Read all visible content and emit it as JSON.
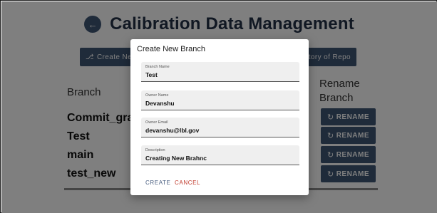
{
  "header": {
    "title": "Calibration Data Management",
    "back_icon": "arrow-left-icon"
  },
  "toolbar": {
    "create_branch_label": "Create New Branch",
    "history_label": "History of Repo",
    "branch_icon": "git-branch-icon"
  },
  "table": {
    "columns": [
      "Branch",
      "Rename Branch"
    ],
    "rows": [
      {
        "branch": "Commit_graph",
        "action": "RENAME"
      },
      {
        "branch": "Test",
        "action": "RENAME"
      },
      {
        "branch": "main",
        "action": "RENAME"
      },
      {
        "branch": "test_new",
        "action": "RENAME"
      }
    ],
    "rename_icon": "refresh-icon"
  },
  "dialog": {
    "title": "Create New Branch",
    "fields": [
      {
        "label": "Branch Name",
        "value": "Test"
      },
      {
        "label": "Owner Name",
        "value": "Devanshu"
      },
      {
        "label": "Owner Email",
        "value": "devanshu@lbl.gov"
      },
      {
        "label": "Description",
        "value": "Creating New Brahnc"
      }
    ],
    "create_label": "CREATE",
    "cancel_label": "CANCEL"
  },
  "colors": {
    "primary": "#3e5675",
    "cancel": "#c0392b",
    "title": "#233047"
  }
}
